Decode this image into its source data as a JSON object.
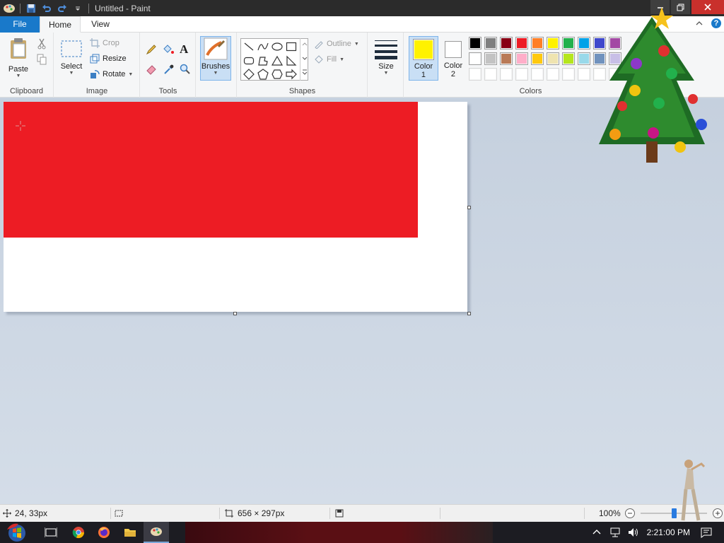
{
  "window": {
    "title": "Untitled - Paint"
  },
  "tabs": [
    {
      "label": "File"
    },
    {
      "label": "Home"
    },
    {
      "label": "View"
    }
  ],
  "ribbon": {
    "clipboard": {
      "label": "Clipboard",
      "paste_label": "Paste"
    },
    "image": {
      "label": "Image",
      "select_label": "Select",
      "crop_label": "Crop",
      "resize_label": "Resize",
      "rotate_label": "Rotate"
    },
    "tools": {
      "label": "Tools"
    },
    "brushes": {
      "label": "Brushes"
    },
    "shapes": {
      "label": "Shapes",
      "outline_label": "Outline",
      "fill_label": "Fill"
    },
    "size": {
      "label": "Size"
    },
    "colors": {
      "label": "Colors",
      "color1_label": "Color\n1",
      "color2_label": "Color\n2",
      "color1": "#fff200",
      "color2": "#ffffff",
      "palette_row1": [
        "#000000",
        "#7f7f7f",
        "#880015",
        "#ed1c24",
        "#ff7f27",
        "#fff200",
        "#22b14c",
        "#00a2e8",
        "#3f48cc",
        "#a349a4"
      ],
      "palette_row2": [
        "#ffffff",
        "#c3c3c3",
        "#b97a57",
        "#ffaec9",
        "#ffc90e",
        "#efe4b0",
        "#b5e61d",
        "#99d9ea",
        "#7092be",
        "#c8bfe7"
      ],
      "palette_row3": [
        "#ffffff",
        "#ffffff",
        "#ffffff",
        "#ffffff",
        "#ffffff",
        "#ffffff",
        "#ffffff",
        "#ffffff",
        "#ffffff",
        "#ffffff"
      ]
    }
  },
  "canvas": {
    "background": "#ffffff",
    "shape_fill": "#ed1c24"
  },
  "status": {
    "cursor_pos": "24, 33px",
    "canvas_size": "656 × 297px",
    "zoom": "100%"
  },
  "taskbar": {
    "time": "2:21:00 PM"
  }
}
